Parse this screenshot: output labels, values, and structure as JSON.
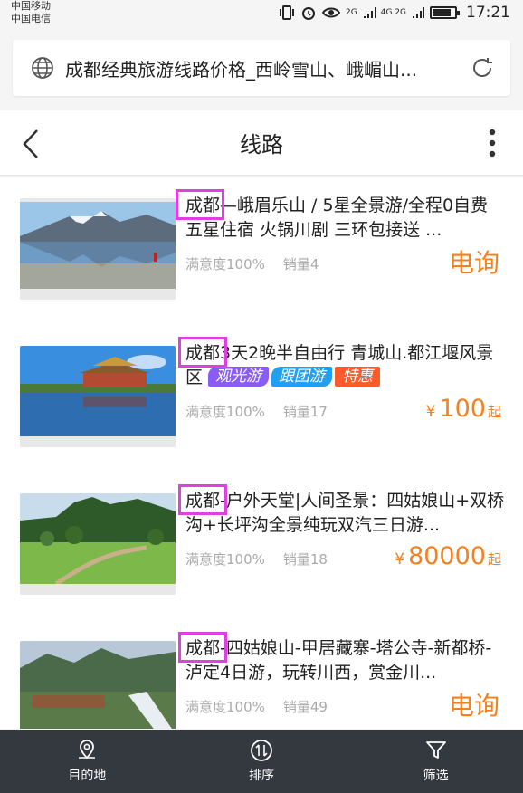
{
  "status_bar": {
    "carrier_1": "中国移动",
    "carrier_2": "中国电信",
    "network_1": "2G",
    "network_2": "4G 2G",
    "time": "17:21"
  },
  "url_bar": {
    "url_text": "成都经典旅游线路价格_西岭雪山、峨嵋山..."
  },
  "header": {
    "title": "线路"
  },
  "routes": [
    {
      "title": "成都—峨眉乐山 / 5星全景游/全程0自费 五星住宿 火锅川剧 三环包接送 ...",
      "satisfaction": "满意度100%",
      "sales": "销量4",
      "price_inquiry": "电询"
    },
    {
      "title": "成都3天2晚半自由行 青城山.都江堰风景区",
      "tags": [
        "观光游",
        "跟团游",
        "特惠"
      ],
      "satisfaction": "满意度100%",
      "sales": "销量17",
      "currency": "¥",
      "price": "100",
      "price_unit": "起"
    },
    {
      "title": "成都-户外天堂|人间圣景：四姑娘山+双桥沟+长坪沟全景纯玩双汽三日游...",
      "satisfaction": "满意度100%",
      "sales": "销量18",
      "currency": "¥",
      "price": "80000",
      "price_unit": "起"
    },
    {
      "title": "成都-四姑娘山-甲居藏寨-塔公寺-新都桥-泸定4日游，玩转川西，赏金川...",
      "satisfaction": "满意度100%",
      "sales": "销量49",
      "price_inquiry": "电询"
    }
  ],
  "tab_bar": {
    "destination": "目的地",
    "sort": "排序",
    "filter": "筛选"
  },
  "colors": {
    "accent_orange": "#f5801f",
    "highlight_magenta": "#e040e0",
    "tab_bar_bg": "#34383f"
  }
}
